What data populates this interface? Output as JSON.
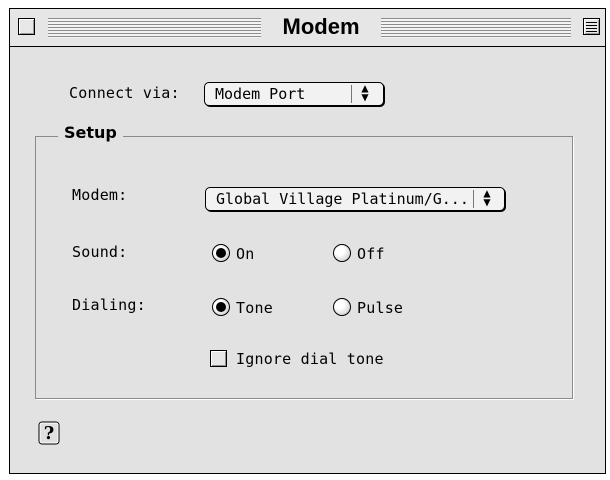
{
  "window": {
    "title": "Modem"
  },
  "connect": {
    "label": "Connect via:",
    "value": "Modem Port"
  },
  "setup": {
    "title": "Setup",
    "modem_label": "Modem:",
    "modem_value": "Global Village Platinum/G...",
    "sound_label": "Sound:",
    "sound_on": "On",
    "sound_off": "Off",
    "sound_selected": "On",
    "dialing_label": "Dialing:",
    "dial_tone": "Tone",
    "dial_pulse": "Pulse",
    "dialing_selected": "Tone",
    "ignore_label": "Ignore dial tone",
    "ignore_checked": false
  },
  "icons": {
    "help": "help-question-icon",
    "popup_arrows": "up-down-arrows-icon"
  }
}
